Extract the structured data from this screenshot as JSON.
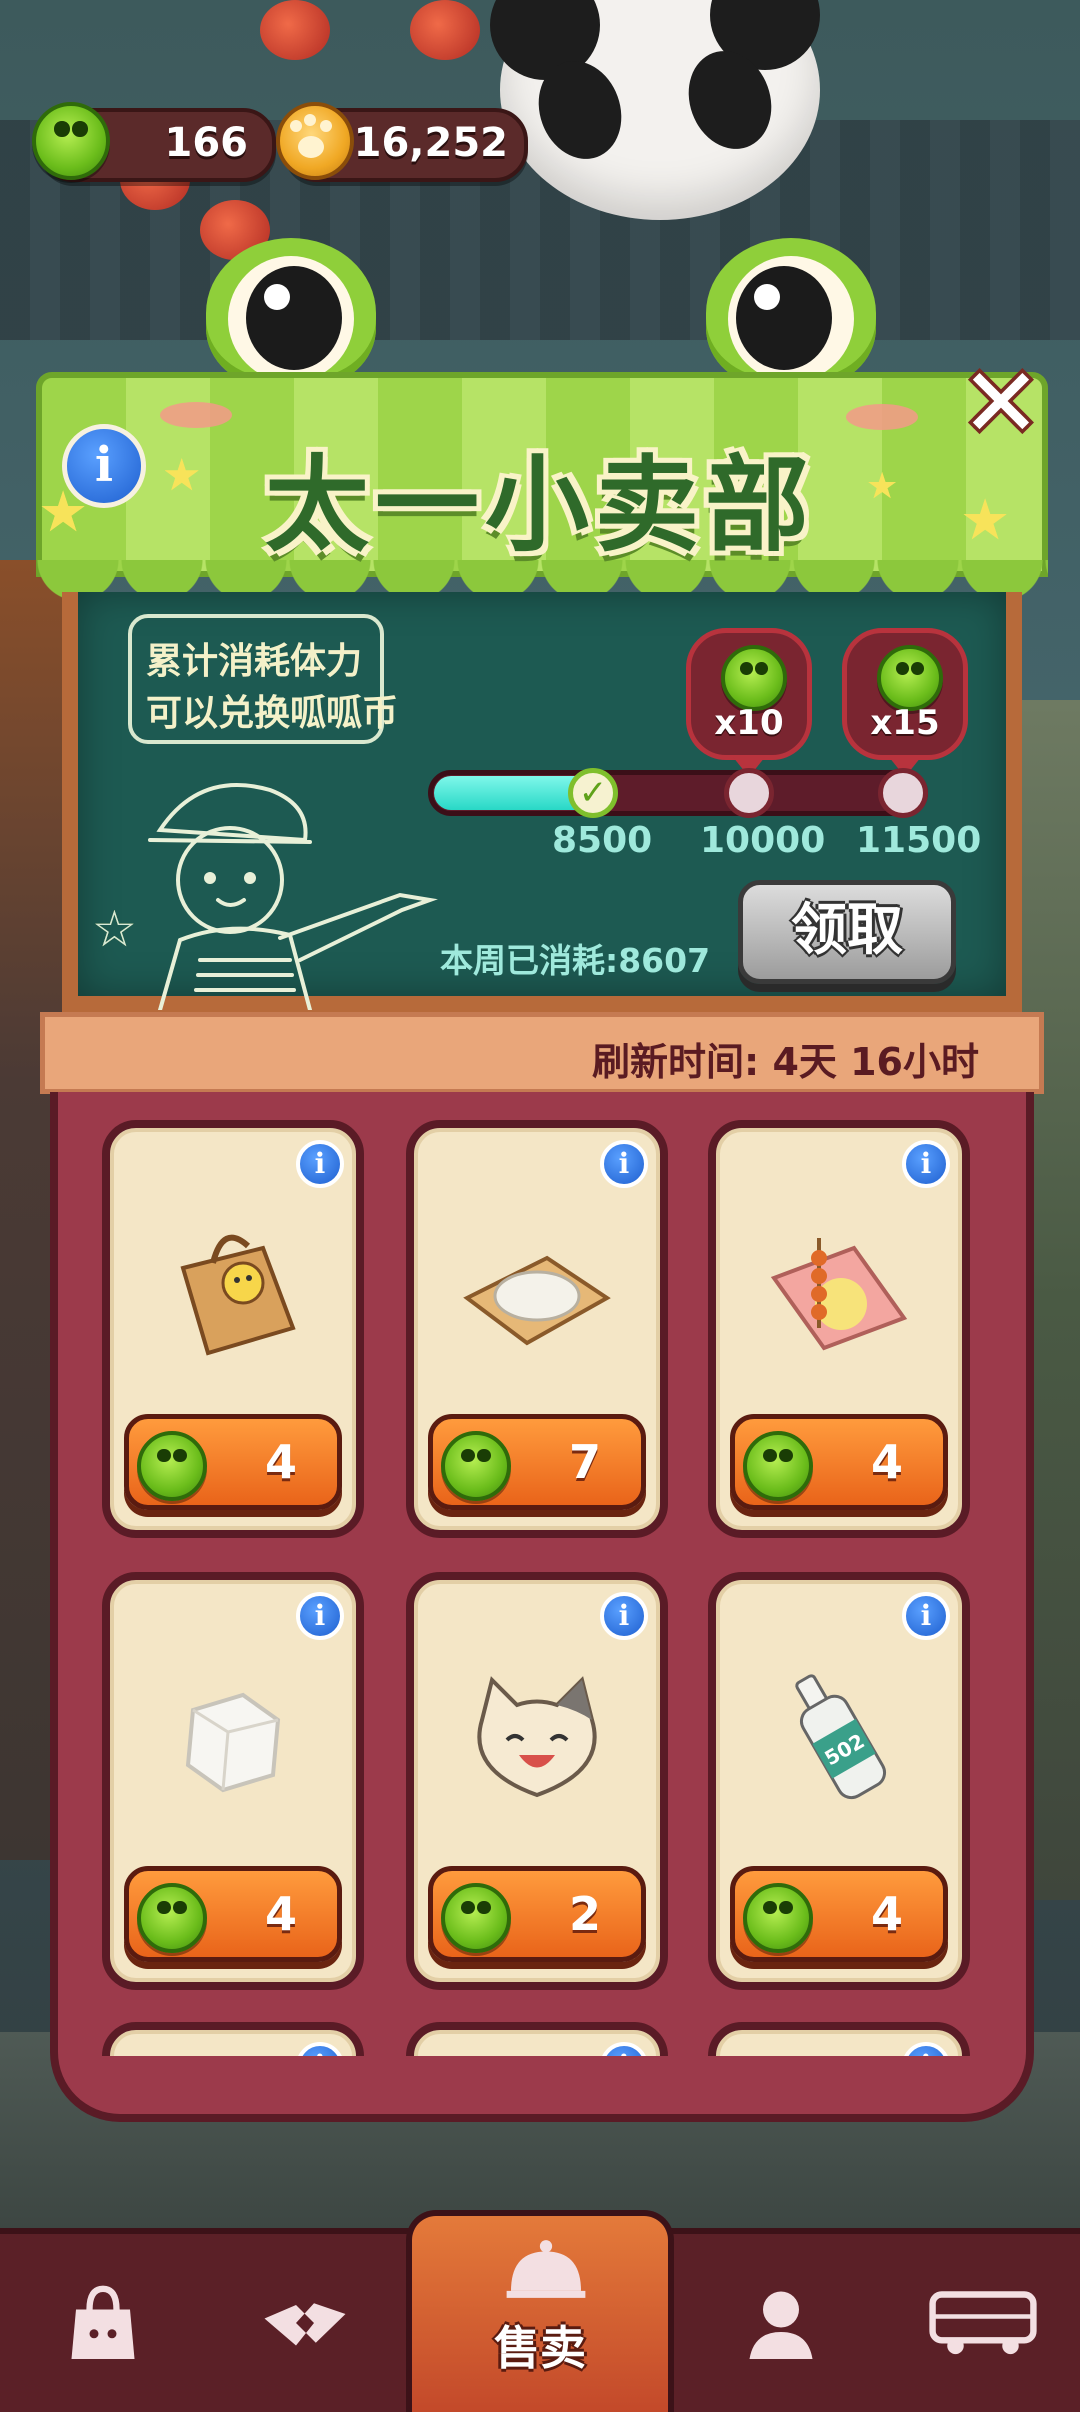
{
  "top_bar": {
    "frog_coin_count": "166",
    "paw_coin_count": "16,252"
  },
  "shop": {
    "title": "太一小卖部",
    "info_icon": "info-icon",
    "close_icon": "close-icon",
    "hint_line1": "累计消耗体力",
    "hint_line2": "可以兑换呱呱币",
    "rewards": [
      {
        "icon": "frog-coin-icon",
        "amount": "x10"
      },
      {
        "icon": "frog-coin-icon",
        "amount": "x15"
      }
    ],
    "progress": {
      "milestones": [
        "8500",
        "10000",
        "11500"
      ],
      "current": 8607,
      "first_milestone_reached": true
    },
    "week_consumed": "本周已消耗:8607",
    "claim_button": "领取",
    "refresh_text": "刷新时间:  4天 16小时"
  },
  "items": [
    {
      "name": "paper-bag",
      "price": "4"
    },
    {
      "name": "rice-on-paper",
      "price": "7"
    },
    {
      "name": "skewer-on-paper",
      "price": "4"
    },
    {
      "name": "sugar-cube",
      "price": "4"
    },
    {
      "name": "cat-face-bun",
      "price": "2"
    },
    {
      "name": "glue-bottle-502",
      "price": "4",
      "label": "502"
    },
    {
      "name": "partial-card",
      "price": ""
    },
    {
      "name": "partial-card",
      "price": ""
    },
    {
      "name": "partial-card",
      "price": ""
    }
  ],
  "nav": {
    "active_label": "售卖",
    "items": [
      "bag-icon",
      "handshake-icon",
      "sell-bell-icon",
      "person-icon",
      "bus-icon"
    ]
  },
  "colors": {
    "awning_green": "#9ed54a",
    "board_green": "#1d5a52",
    "panel_maroon": "#9c3a4b",
    "price_orange": "#e9641a",
    "progress_cyan": "#28d8c6"
  }
}
